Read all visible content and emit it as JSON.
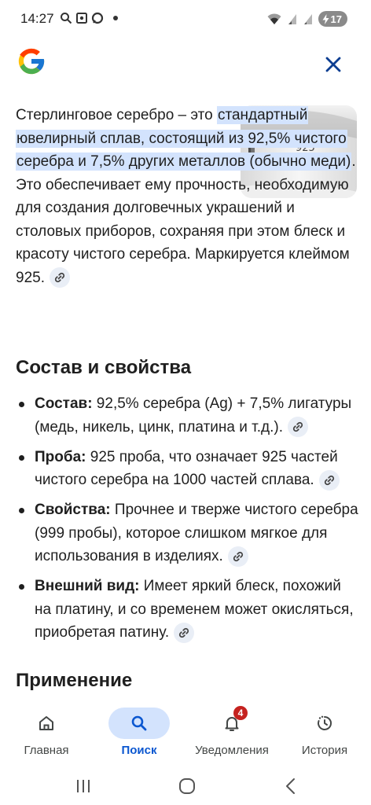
{
  "status_bar": {
    "time": "14:27",
    "battery_level": "17",
    "icons": [
      "search-icon",
      "screenshot-icon",
      "chat-icon",
      "wifi-icon",
      "signal-icon",
      "signal-icon",
      "battery-icon"
    ]
  },
  "header": {
    "logo": "google-logo",
    "close_icon": "close-icon"
  },
  "intro": {
    "text_before": "Стерлинговое серебро – это ",
    "highlight": "стандартный ювелирный сплав, состоящий из 92,5% чистого серебра и 7,5% других металлов (обычно меди)",
    "text_after": ". Это обеспечивает ему прочность, необходимую для создания долговечных украшений и столовых приборов, сохраняя при этом блеск и красоту чистого серебра. Маркируется клеймом 925.",
    "image_stamp_text": "925"
  },
  "sections": [
    {
      "title": "Состав и свойства",
      "items": [
        {
          "label": "Состав:",
          "text": " 92,5% серебра (Ag) + 7,5% лигатуры (медь, никель, цинк, платина и т.д.)."
        },
        {
          "label": "Проба:",
          "text": " 925 проба, что означает 925 частей чистого серебра на 1000 частей сплава."
        },
        {
          "label": "Свойства:",
          "text": " Прочнее и тверже чистого серебра (999 пробы), которое слишком мягкое для использования в изделиях."
        },
        {
          "label": "Внешний вид:",
          "text": " Имеет яркий блеск, похожий на платину, и со временем может окисляться, приобретая патину."
        }
      ]
    },
    {
      "title": "Применение"
    }
  ],
  "bottom_nav": {
    "items": [
      {
        "label": "Главная",
        "icon": "home-icon",
        "active": false
      },
      {
        "label": "Поиск",
        "icon": "search-icon",
        "active": true
      },
      {
        "label": "Уведомления",
        "icon": "bell-icon",
        "active": false,
        "badge": "4"
      },
      {
        "label": "История",
        "icon": "history-icon",
        "active": false
      }
    ]
  },
  "colors": {
    "highlight": "#d3e3fd",
    "accent": "#0b57d0",
    "badge": "#c5221f",
    "close": "#0b3d91"
  }
}
